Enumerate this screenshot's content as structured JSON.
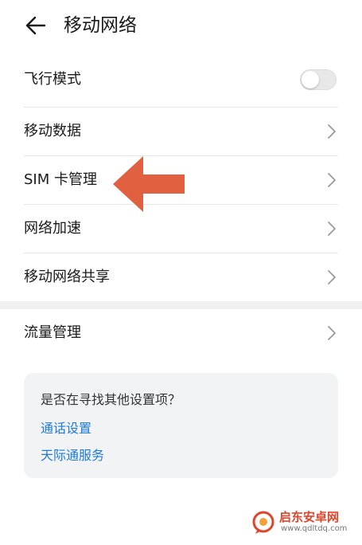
{
  "header": {
    "back_icon": "arrow-left-icon",
    "title": "移动网络"
  },
  "settings": [
    {
      "label": "飞行模式",
      "control": "toggle",
      "toggle_on": false
    },
    {
      "label": "移动数据",
      "control": "chevron",
      "icon": "chevron-right-icon"
    },
    {
      "label": "SIM 卡管理",
      "control": "chevron",
      "icon": "chevron-right-icon"
    },
    {
      "label": "网络加速",
      "control": "chevron",
      "icon": "chevron-right-icon"
    },
    {
      "label": "移动网络共享",
      "control": "chevron",
      "icon": "chevron-right-icon"
    }
  ],
  "settings_group2": [
    {
      "label": "流量管理",
      "control": "chevron",
      "icon": "chevron-right-icon"
    }
  ],
  "suggestions": {
    "title": "是否在寻找其他设置项？",
    "links": [
      "通话设置",
      "天际通服务"
    ],
    "link_color": "#1f7ad6"
  },
  "annotation": {
    "icon": "arrow-left-icon",
    "color": "#e0603f"
  },
  "watermark": {
    "name": "启东安卓网",
    "url": "www.qdltdq.com",
    "logo_icon": "chat-bubble-logo-icon"
  },
  "colors": {
    "toggle_off": "#e8e8e8",
    "divider": "#e6e6e6",
    "card_bg": "#f1f3f5"
  }
}
